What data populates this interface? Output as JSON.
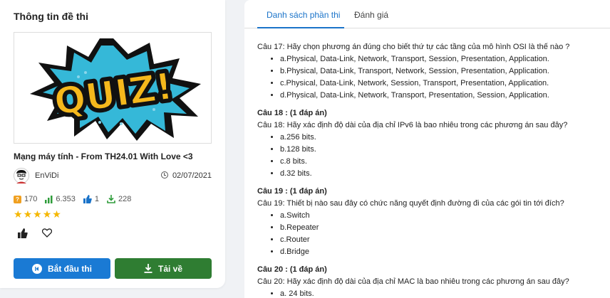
{
  "left": {
    "title": "Thông tin đề thi",
    "quiz_image_text": "QUIZ!",
    "exam_name": "Mạng máy tính - From TH24.01 With Love <3",
    "author": "EnViDi",
    "date": "02/07/2021",
    "stats": {
      "questions": "170",
      "views": "6.353",
      "likes": "1",
      "downloads": "228"
    },
    "rating": 5,
    "start_button": "Bắt đầu thi",
    "download_button": "Tải về"
  },
  "tabs": [
    {
      "label": "Danh sách phần thi",
      "active": true
    },
    {
      "label": "Đánh giá",
      "active": false
    }
  ],
  "questions": [
    {
      "header": "",
      "text": "Câu 17: Hãy chọn phương án đúng cho biết thứ tự các tầng của mô hình OSI là thế nào ?",
      "options": [
        "a.Physical, Data-Link, Network, Transport, Session, Presentation, Application.",
        "b.Physical, Data-Link, Transport, Network, Session, Presentation, Application.",
        "c.Physical, Data-Link, Network, Session, Transport, Presentation, Application.",
        "d.Physical, Data-Link, Network, Transport, Presentation, Session, Application."
      ]
    },
    {
      "header": "Câu 18 : (1 đáp án)",
      "text": "Câu 18: Hãy xác định độ dài của địa chỉ IPv6 là bao nhiêu trong các phương án sau đây?",
      "options": [
        "a.256 bits.",
        "b.128 bits.",
        "c.8 bits.",
        "d.32 bits."
      ]
    },
    {
      "header": "Câu 19 : (1 đáp án)",
      "text": "Câu 19: Thiết bị nào sau đây có chức năng quyết định đường đi của các gói tin tới đích?",
      "options": [
        "a.Switch",
        "b.Repeater",
        "c.Router",
        "d.Bridge"
      ]
    },
    {
      "header": "Câu 20 : (1 đáp án)",
      "text": "Câu 20: Hãy xác định độ dài của địa chỉ MAC là bao nhiêu trong các phương án sau đây?",
      "options": [
        "a. 24 bits."
      ]
    }
  ],
  "colors": {
    "primary": "#1a7ad4",
    "success": "#2f7d32",
    "star": "#f5b700",
    "tab_active": "#1a73c9"
  }
}
